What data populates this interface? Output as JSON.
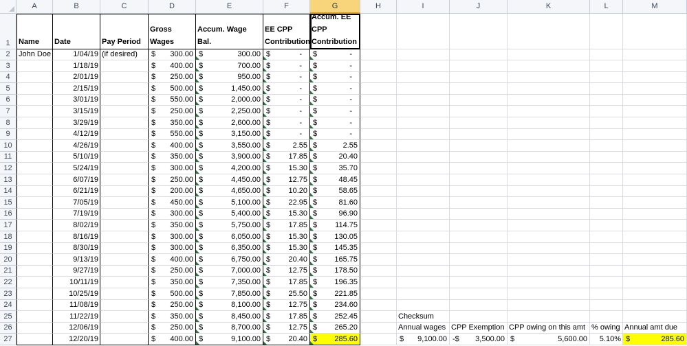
{
  "columns": [
    "A",
    "B",
    "C",
    "D",
    "E",
    "F",
    "G",
    "H",
    "I",
    "J",
    "K",
    "L",
    "M"
  ],
  "selected_column": "G",
  "header_row": {
    "name": "Name",
    "date": "Date",
    "pay_period": "Pay Period",
    "gross_wages": "Gross Wages",
    "accum_wage_bal": "Accum. Wage Bal.",
    "ee_cpp": [
      "EE CPP",
      "Contribution"
    ],
    "accum_ee_cpp": [
      "Accum. EE",
      "CPP",
      "Contribution"
    ]
  },
  "employee_name": "John Doe",
  "pay_period_note": "(if desired)",
  "currency_symbol": "$",
  "rows": [
    {
      "row": "2",
      "date": "1/04/19",
      "gross": "300.00",
      "accum": "300.00",
      "ee": "-",
      "accum_ee": "-"
    },
    {
      "row": "3",
      "date": "1/18/19",
      "gross": "400.00",
      "accum": "700.00",
      "ee": "-",
      "accum_ee": "-"
    },
    {
      "row": "4",
      "date": "2/01/19",
      "gross": "250.00",
      "accum": "950.00",
      "ee": "-",
      "accum_ee": "-"
    },
    {
      "row": "5",
      "date": "2/15/19",
      "gross": "500.00",
      "accum": "1,450.00",
      "ee": "-",
      "accum_ee": "-"
    },
    {
      "row": "6",
      "date": "3/01/19",
      "gross": "550.00",
      "accum": "2,000.00",
      "ee": "-",
      "accum_ee": "-"
    },
    {
      "row": "7",
      "date": "3/15/19",
      "gross": "250.00",
      "accum": "2,250.00",
      "ee": "-",
      "accum_ee": "-"
    },
    {
      "row": "8",
      "date": "3/29/19",
      "gross": "350.00",
      "accum": "2,600.00",
      "ee": "-",
      "accum_ee": "-"
    },
    {
      "row": "9",
      "date": "4/12/19",
      "gross": "550.00",
      "accum": "3,150.00",
      "ee": "-",
      "accum_ee": "-"
    },
    {
      "row": "10",
      "date": "4/26/19",
      "gross": "400.00",
      "accum": "3,550.00",
      "ee": "2.55",
      "accum_ee": "2.55"
    },
    {
      "row": "11",
      "date": "5/10/19",
      "gross": "350.00",
      "accum": "3,900.00",
      "ee": "17.85",
      "accum_ee": "20.40"
    },
    {
      "row": "12",
      "date": "5/24/19",
      "gross": "300.00",
      "accum": "4,200.00",
      "ee": "15.30",
      "accum_ee": "35.70"
    },
    {
      "row": "13",
      "date": "6/07/19",
      "gross": "250.00",
      "accum": "4,450.00",
      "ee": "12.75",
      "accum_ee": "48.45"
    },
    {
      "row": "14",
      "date": "6/21/19",
      "gross": "200.00",
      "accum": "4,650.00",
      "ee": "10.20",
      "accum_ee": "58.65"
    },
    {
      "row": "15",
      "date": "7/05/19",
      "gross": "450.00",
      "accum": "5,100.00",
      "ee": "22.95",
      "accum_ee": "81.60"
    },
    {
      "row": "16",
      "date": "7/19/19",
      "gross": "300.00",
      "accum": "5,400.00",
      "ee": "15.30",
      "accum_ee": "96.90"
    },
    {
      "row": "17",
      "date": "8/02/19",
      "gross": "350.00",
      "accum": "5,750.00",
      "ee": "17.85",
      "accum_ee": "114.75"
    },
    {
      "row": "18",
      "date": "8/16/19",
      "gross": "300.00",
      "accum": "6,050.00",
      "ee": "15.30",
      "accum_ee": "130.05"
    },
    {
      "row": "19",
      "date": "8/30/19",
      "gross": "300.00",
      "accum": "6,350.00",
      "ee": "15.30",
      "accum_ee": "145.35"
    },
    {
      "row": "20",
      "date": "9/13/19",
      "gross": "400.00",
      "accum": "6,750.00",
      "ee": "20.40",
      "accum_ee": "165.75"
    },
    {
      "row": "21",
      "date": "9/27/19",
      "gross": "250.00",
      "accum": "7,000.00",
      "ee": "12.75",
      "accum_ee": "178.50"
    },
    {
      "row": "22",
      "date": "10/11/19",
      "gross": "350.00",
      "accum": "7,350.00",
      "ee": "17.85",
      "accum_ee": "196.35"
    },
    {
      "row": "23",
      "date": "10/25/19",
      "gross": "500.00",
      "accum": "7,850.00",
      "ee": "25.50",
      "accum_ee": "221.85"
    },
    {
      "row": "24",
      "date": "11/08/19",
      "gross": "250.00",
      "accum": "8,100.00",
      "ee": "12.75",
      "accum_ee": "234.60"
    },
    {
      "row": "25",
      "date": "11/22/19",
      "gross": "350.00",
      "accum": "8,450.00",
      "ee": "17.85",
      "accum_ee": "252.45"
    },
    {
      "row": "26",
      "date": "12/06/19",
      "gross": "250.00",
      "accum": "8,700.00",
      "ee": "12.75",
      "accum_ee": "265.20"
    },
    {
      "row": "27",
      "date": "12/20/19",
      "gross": "400.00",
      "accum": "9,100.00",
      "ee": "20.40",
      "accum_ee": "285.60"
    }
  ],
  "checksum": {
    "title": "Checksum",
    "headers": {
      "annual_wages": "Annual wages",
      "cpp_exemption": "CPP Exemption",
      "cpp_owing": "CPP owing on this amt",
      "pct_owing": "% owing",
      "annual_amt_due": "Annual amt due"
    },
    "values": {
      "annual_wages": "9,100.00",
      "cpp_exemption_prefix": "-$",
      "cpp_exemption": "3,500.00",
      "cpp_owing": "5,600.00",
      "pct_owing": "5.10%",
      "annual_amt_due": "285.60"
    }
  },
  "colors": {
    "highlight": "#ffff00",
    "selected_header": "#f8d47a",
    "gridline": "#d9dde3",
    "error_indicator": "#1e7a36"
  }
}
